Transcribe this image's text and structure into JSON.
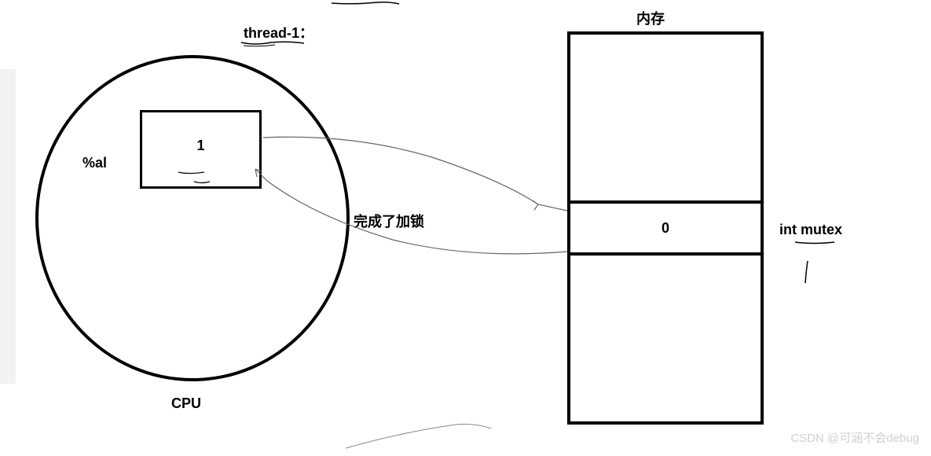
{
  "diagram": {
    "thread_label": "thread-1：",
    "register_label": "%al",
    "register_value": "1",
    "cpu_label": "CPU",
    "lock_status": "完成了加锁",
    "memory_label": "内存",
    "memory_cell_value": "0",
    "mutex_label": "int mutex",
    "watermark": "CSDN @可涵不会debug"
  }
}
